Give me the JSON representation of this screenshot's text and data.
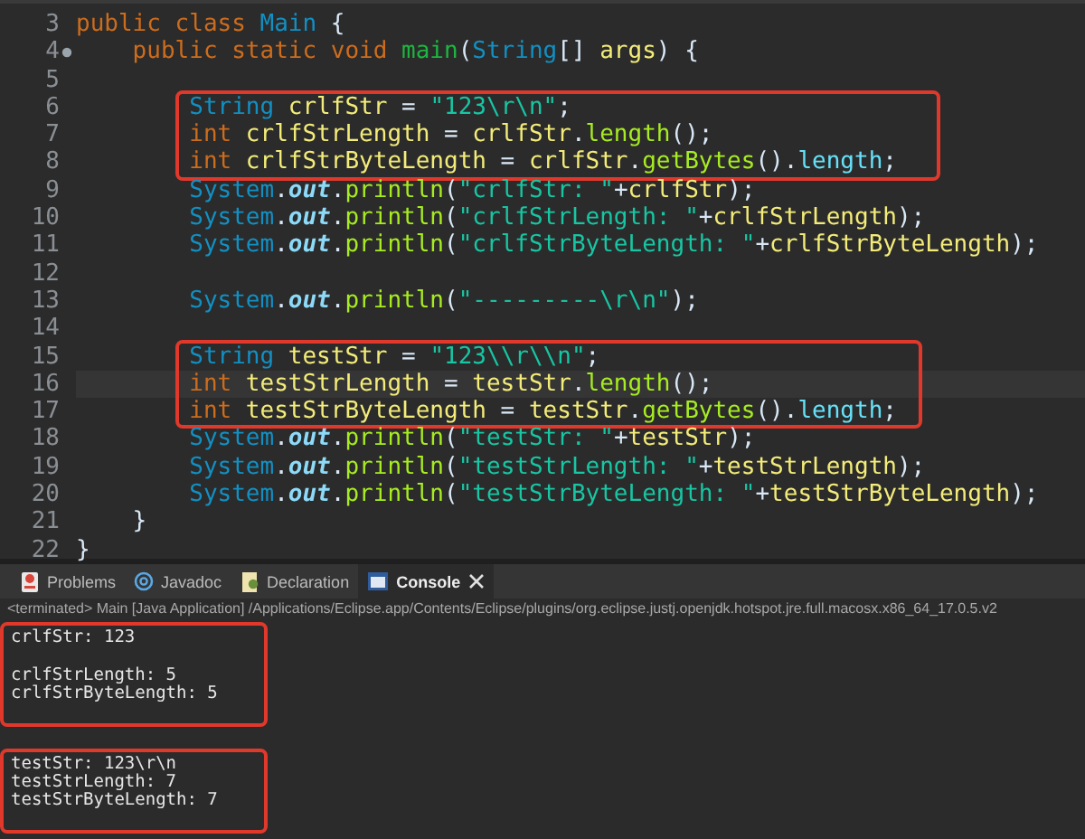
{
  "editor": {
    "blocks": [
      {
        "boxed": false,
        "lines": [
          {
            "number": "3",
            "tokens": [
              {
                "kind": "kw",
                "text": "public class "
              },
              {
                "kind": "cls",
                "text": "Main"
              },
              {
                "kind": "p",
                "text": " {"
              }
            ]
          },
          {
            "number": "4",
            "fold": true,
            "tokens": [
              {
                "kind": "kw",
                "text": "    public static void "
              },
              {
                "kind": "decl",
                "text": "main"
              },
              {
                "kind": "p",
                "text": "("
              },
              {
                "kind": "cls",
                "text": "String"
              },
              {
                "kind": "p",
                "text": "[] "
              },
              {
                "kind": "var",
                "text": "args"
              },
              {
                "kind": "p",
                "text": ") {"
              }
            ]
          },
          {
            "number": "5"
          }
        ]
      },
      {
        "boxed": true,
        "lines": [
          {
            "number": "6",
            "tokens": [
              {
                "kind": "cls",
                "text": "        String "
              },
              {
                "kind": "var",
                "text": "crlfStr"
              },
              {
                "kind": "p",
                "text": " = "
              },
              {
                "kind": "str",
                "text": "\"123\\r\\n\""
              },
              {
                "kind": "p",
                "text": ";"
              }
            ]
          },
          {
            "number": "7",
            "tokens": [
              {
                "kind": "kw",
                "text": "        int "
              },
              {
                "kind": "var",
                "text": "crlfStrLength"
              },
              {
                "kind": "p",
                "text": " = "
              },
              {
                "kind": "var",
                "text": "crlfStr"
              },
              {
                "kind": "p",
                "text": "."
              },
              {
                "kind": "call",
                "text": "length"
              },
              {
                "kind": "p",
                "text": "();"
              }
            ]
          },
          {
            "number": "8",
            "tokens": [
              {
                "kind": "kw",
                "text": "        int "
              },
              {
                "kind": "var",
                "text": "crlfStrByteLength"
              },
              {
                "kind": "p",
                "text": " = "
              },
              {
                "kind": "var",
                "text": "crlfStr"
              },
              {
                "kind": "p",
                "text": "."
              },
              {
                "kind": "call",
                "text": "getBytes"
              },
              {
                "kind": "p",
                "text": "()."
              },
              {
                "kind": "field",
                "text": "length"
              },
              {
                "kind": "p",
                "text": ";"
              }
            ]
          }
        ]
      },
      {
        "boxed": false,
        "lines": [
          {
            "number": "9",
            "tokens": [
              {
                "kind": "cls",
                "text": "        System"
              },
              {
                "kind": "p",
                "text": "."
              },
              {
                "kind": "sfield",
                "text": "out"
              },
              {
                "kind": "p",
                "text": "."
              },
              {
                "kind": "call",
                "text": "println"
              },
              {
                "kind": "p",
                "text": "("
              },
              {
                "kind": "str",
                "text": "\"crlfStr: \""
              },
              {
                "kind": "p",
                "text": "+"
              },
              {
                "kind": "var",
                "text": "crlfStr"
              },
              {
                "kind": "p",
                "text": ");"
              }
            ]
          },
          {
            "number": "10",
            "tokens": [
              {
                "kind": "cls",
                "text": "        System"
              },
              {
                "kind": "p",
                "text": "."
              },
              {
                "kind": "sfield",
                "text": "out"
              },
              {
                "kind": "p",
                "text": "."
              },
              {
                "kind": "call",
                "text": "println"
              },
              {
                "kind": "p",
                "text": "("
              },
              {
                "kind": "str",
                "text": "\"crlfStrLength: \""
              },
              {
                "kind": "p",
                "text": "+"
              },
              {
                "kind": "var",
                "text": "crlfStrLength"
              },
              {
                "kind": "p",
                "text": ");"
              }
            ]
          },
          {
            "number": "11",
            "tokens": [
              {
                "kind": "cls",
                "text": "        System"
              },
              {
                "kind": "p",
                "text": "."
              },
              {
                "kind": "sfield",
                "text": "out"
              },
              {
                "kind": "p",
                "text": "."
              },
              {
                "kind": "call",
                "text": "println"
              },
              {
                "kind": "p",
                "text": "("
              },
              {
                "kind": "str",
                "text": "\"crlfStrByteLength: \""
              },
              {
                "kind": "p",
                "text": "+"
              },
              {
                "kind": "var",
                "text": "crlfStrByteLength"
              },
              {
                "kind": "p",
                "text": ");"
              }
            ]
          },
          {
            "number": "12"
          },
          {
            "number": "13",
            "tokens": [
              {
                "kind": "cls",
                "text": "        System"
              },
              {
                "kind": "p",
                "text": "."
              },
              {
                "kind": "sfield",
                "text": "out"
              },
              {
                "kind": "p",
                "text": "."
              },
              {
                "kind": "call",
                "text": "println"
              },
              {
                "kind": "p",
                "text": "("
              },
              {
                "kind": "str",
                "text": "\"---------\\r\\n\""
              },
              {
                "kind": "p",
                "text": ");"
              }
            ]
          },
          {
            "number": "14"
          }
        ]
      },
      {
        "boxed": true,
        "lines": [
          {
            "number": "15",
            "tokens": [
              {
                "kind": "cls",
                "text": "        String "
              },
              {
                "kind": "var",
                "text": "testStr"
              },
              {
                "kind": "p",
                "text": " = "
              },
              {
                "kind": "str",
                "text": "\"123\\\\r\\\\n\""
              },
              {
                "kind": "p",
                "text": ";"
              }
            ]
          },
          {
            "number": "16",
            "current": true,
            "tokens": [
              {
                "kind": "kw",
                "text": "        int "
              },
              {
                "kind": "var",
                "text": "testStrLength"
              },
              {
                "kind": "p",
                "text": " = "
              },
              {
                "kind": "var",
                "text": "testStr"
              },
              {
                "kind": "p",
                "text": "."
              },
              {
                "kind": "call",
                "text": "length"
              },
              {
                "kind": "p",
                "text": "();"
              }
            ]
          },
          {
            "number": "17",
            "tokens": [
              {
                "kind": "kw",
                "text": "        int "
              },
              {
                "kind": "var",
                "text": "testStrByteLength"
              },
              {
                "kind": "p",
                "text": " = "
              },
              {
                "kind": "var",
                "text": "testStr"
              },
              {
                "kind": "p",
                "text": "."
              },
              {
                "kind": "call",
                "text": "getBytes"
              },
              {
                "kind": "p",
                "text": "()."
              },
              {
                "kind": "field",
                "text": "length"
              },
              {
                "kind": "p",
                "text": ";"
              }
            ]
          }
        ]
      },
      {
        "boxed": false,
        "lines": [
          {
            "number": "18",
            "tokens": [
              {
                "kind": "cls",
                "text": "        System"
              },
              {
                "kind": "p",
                "text": "."
              },
              {
                "kind": "sfield",
                "text": "out"
              },
              {
                "kind": "p",
                "text": "."
              },
              {
                "kind": "call",
                "text": "println"
              },
              {
                "kind": "p",
                "text": "("
              },
              {
                "kind": "str",
                "text": "\"testStr: \""
              },
              {
                "kind": "p",
                "text": "+"
              },
              {
                "kind": "var",
                "text": "testStr"
              },
              {
                "kind": "p",
                "text": ");"
              }
            ]
          },
          {
            "number": "19",
            "tokens": [
              {
                "kind": "cls",
                "text": "        System"
              },
              {
                "kind": "p",
                "text": "."
              },
              {
                "kind": "sfield",
                "text": "out"
              },
              {
                "kind": "p",
                "text": "."
              },
              {
                "kind": "call",
                "text": "println"
              },
              {
                "kind": "p",
                "text": "("
              },
              {
                "kind": "str",
                "text": "\"testStrLength: \""
              },
              {
                "kind": "p",
                "text": "+"
              },
              {
                "kind": "var",
                "text": "testStrLength"
              },
              {
                "kind": "p",
                "text": ");"
              }
            ]
          },
          {
            "number": "20",
            "tokens": [
              {
                "kind": "cls",
                "text": "        System"
              },
              {
                "kind": "p",
                "text": "."
              },
              {
                "kind": "sfield",
                "text": "out"
              },
              {
                "kind": "p",
                "text": "."
              },
              {
                "kind": "call",
                "text": "println"
              },
              {
                "kind": "p",
                "text": "("
              },
              {
                "kind": "str",
                "text": "\"testStrByteLength: \""
              },
              {
                "kind": "p",
                "text": "+"
              },
              {
                "kind": "var",
                "text": "testStrByteLength"
              },
              {
                "kind": "p",
                "text": ");"
              }
            ]
          },
          {
            "number": "21",
            "tokens": [
              {
                "kind": "p",
                "text": "    }"
              }
            ]
          },
          {
            "number": "22",
            "tokens": [
              {
                "kind": "p",
                "text": "}"
              }
            ]
          }
        ]
      }
    ]
  },
  "panel": {
    "tabs": [
      {
        "kind": "problems",
        "label": "Problems",
        "selected": false
      },
      {
        "kind": "javadoc",
        "label": "Javadoc",
        "selected": false
      },
      {
        "kind": "declaration",
        "label": "Declaration",
        "selected": false
      },
      {
        "kind": "console",
        "label": "Console",
        "selected": true,
        "closable": true
      }
    ],
    "status": "<terminated> Main [Java Application] /Applications/Eclipse.app/Contents/Eclipse/plugins/org.eclipse.justj.openjdk.hotspot.jre.full.macosx.x86_64_17.0.5.v2",
    "output": [
      {
        "boxed": true,
        "lines": [
          {
            "text": "crlfStr: 123"
          },
          {
            "kind": "blank"
          },
          {
            "text": "crlfStrLength: 5"
          },
          {
            "text": "crlfStrByteLength: 5"
          }
        ]
      },
      {
        "boxed": true,
        "lines": [
          {
            "text": "testStr: 123\\r\\n"
          },
          {
            "text": "testStrLength: 7"
          },
          {
            "text": "testStrByteLength: 7"
          }
        ]
      }
    ]
  }
}
